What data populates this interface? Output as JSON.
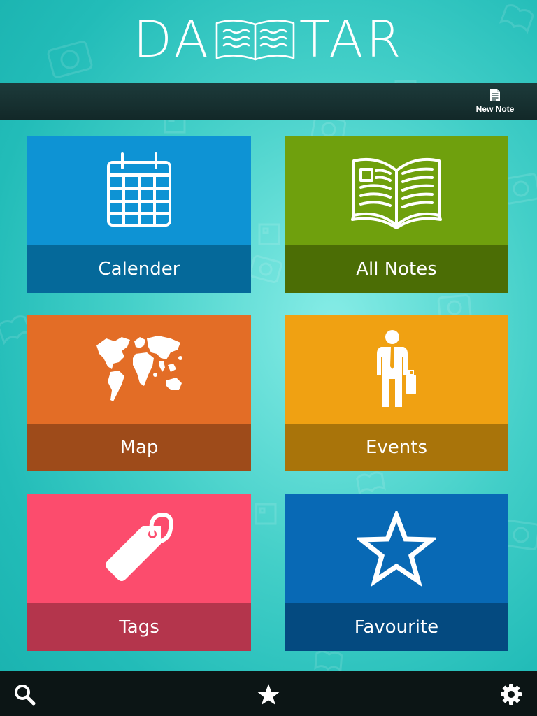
{
  "app": {
    "logo_left": "DA",
    "logo_right": "TAR"
  },
  "toolbar": {
    "new_note_label": "New Note",
    "new_note_icon": "document-icon"
  },
  "tiles": [
    {
      "id": "calendar",
      "label": "Calender",
      "icon": "calendar-icon",
      "top_color": "#0e93d4",
      "bottom_color": "#05699a"
    },
    {
      "id": "notes",
      "label": "All Notes",
      "icon": "open-book-icon",
      "top_color": "#6fa00d",
      "bottom_color": "#4b6d05"
    },
    {
      "id": "map",
      "label": "Map",
      "icon": "world-map-icon",
      "top_color": "#e36d26",
      "bottom_color": "#9e4b1a"
    },
    {
      "id": "events",
      "label": "Events",
      "icon": "businessman-icon",
      "top_color": "#f0a112",
      "bottom_color": "#a9740a"
    },
    {
      "id": "tags",
      "label": "Tags",
      "icon": "tag-icon",
      "top_color": "#fc4c6d",
      "bottom_color": "#b4354c"
    },
    {
      "id": "favourite",
      "label": "Favourite",
      "icon": "star-outline-icon",
      "top_color": "#0869b5",
      "bottom_color": "#044a80"
    }
  ],
  "bottom_bar": {
    "icons": [
      "search-icon",
      "star-icon",
      "gear-icon"
    ]
  },
  "colors": {
    "background": "#43cfc8",
    "toolbar": "#1d3b3b",
    "bottom_bar": "#0c1515"
  }
}
